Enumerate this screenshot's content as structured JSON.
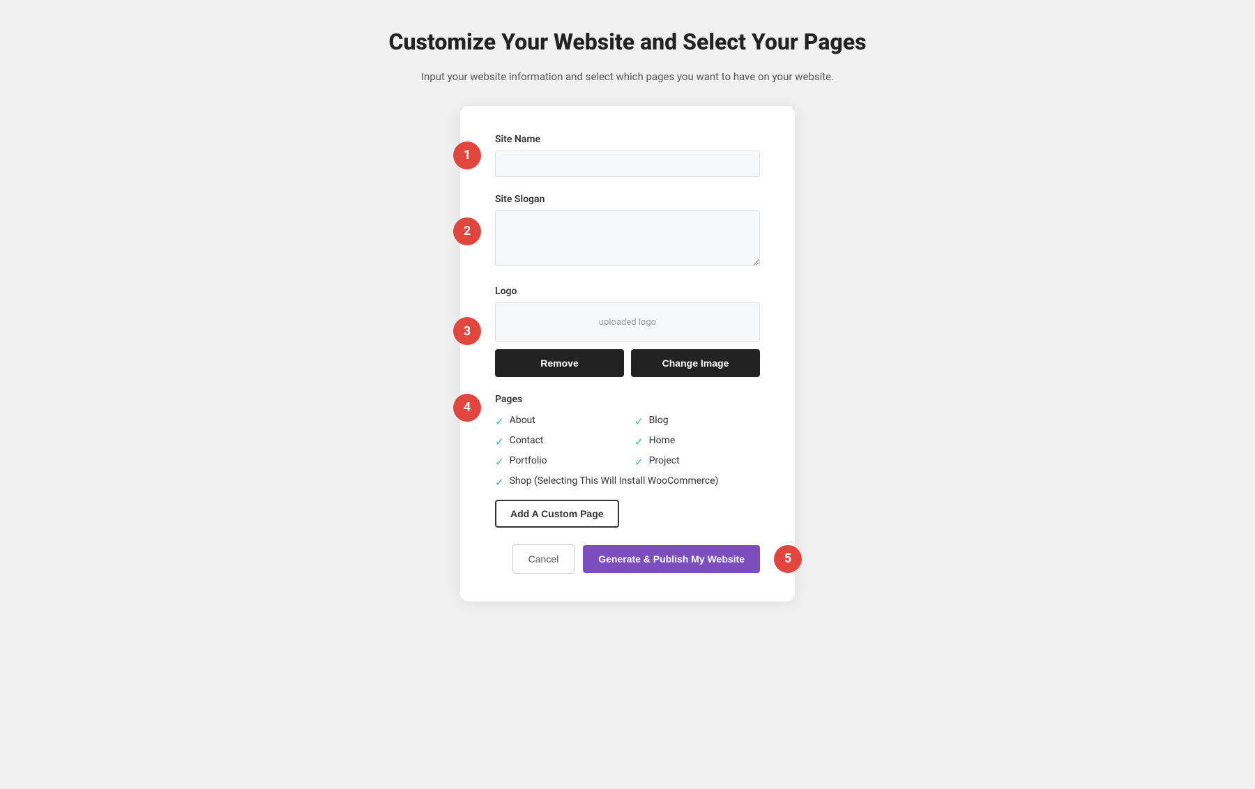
{
  "header": {
    "title": "Customize Your Website and Select Your Pages",
    "subtitle": "Input your website information and select which pages you want to have on your website."
  },
  "form": {
    "site_name": {
      "label": "Site Name",
      "placeholder": "",
      "value": "",
      "step": "1"
    },
    "site_slogan": {
      "label": "Site Slogan",
      "placeholder": "",
      "value": "",
      "step": "2"
    },
    "logo": {
      "label": "Logo",
      "preview_text": "uploaded logo",
      "remove_label": "Remove",
      "change_label": "Change Image",
      "step": "3"
    },
    "pages": {
      "label": "Pages",
      "step": "4",
      "items": [
        {
          "name": "About",
          "checked": true,
          "col": 1
        },
        {
          "name": "Blog",
          "checked": true,
          "col": 2
        },
        {
          "name": "Contact",
          "checked": true,
          "col": 1
        },
        {
          "name": "Home",
          "checked": true,
          "col": 2
        },
        {
          "name": "Portfolio",
          "checked": true,
          "col": 1
        },
        {
          "name": "Project",
          "checked": true,
          "col": 2
        },
        {
          "name": "Shop (Selecting This Will Install WooCommerce)",
          "checked": true,
          "col": 1
        }
      ],
      "add_custom_label": "Add A Custom Page"
    },
    "footer": {
      "cancel_label": "Cancel",
      "publish_label": "Generate & Publish My Website",
      "step": "5"
    }
  }
}
